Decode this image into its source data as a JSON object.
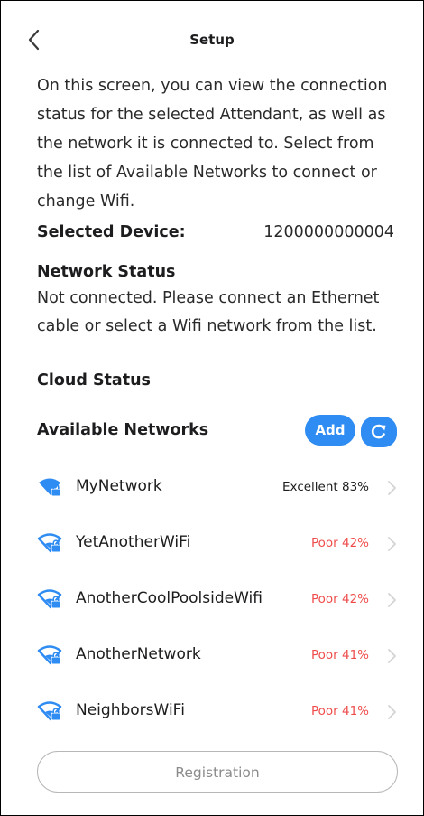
{
  "header": {
    "title": "Setup"
  },
  "intro": {
    "text": "On this screen, you can view the connection status for the selected Attendant, as well as the network it is connected to.  Select from the list of Available Networks to connect or change Wifi."
  },
  "selected_device": {
    "label": "Selected Device:",
    "value": "1200000000004"
  },
  "network_status": {
    "title": "Network Status",
    "message": "Not connected.  Please connect an Ethernet cable or select a Wifi network from the list."
  },
  "cloud_status": {
    "title": "Cloud Status"
  },
  "available_networks": {
    "title": "Available Networks",
    "add_label": "Add",
    "items": [
      {
        "name": "MyNetwork",
        "strength": "Excellent 83%",
        "quality": "excellent",
        "color": "#1d1d1f",
        "icon": "wifi-locked-strong-icon"
      },
      {
        "name": "YetAnotherWiFi",
        "strength": "Poor 42%",
        "quality": "poor",
        "color": "#ef4d4d",
        "icon": "wifi-locked-weak-icon"
      },
      {
        "name": "AnotherCoolPoolsideWifi",
        "strength": "Poor 42%",
        "quality": "poor",
        "color": "#ef4d4d",
        "icon": "wifi-locked-weak-icon"
      },
      {
        "name": "AnotherNetwork",
        "strength": "Poor 41%",
        "quality": "poor",
        "color": "#ef4d4d",
        "icon": "wifi-locked-weak-icon"
      },
      {
        "name": "NeighborsWiFi",
        "strength": "Poor 41%",
        "quality": "poor",
        "color": "#ef4d4d",
        "icon": "wifi-locked-weak-icon"
      }
    ]
  },
  "registration": {
    "label": "Registration"
  },
  "colors": {
    "accent": "#2f8cf2",
    "poor": "#ef4d4d",
    "button_border": "#b7b7b7"
  }
}
